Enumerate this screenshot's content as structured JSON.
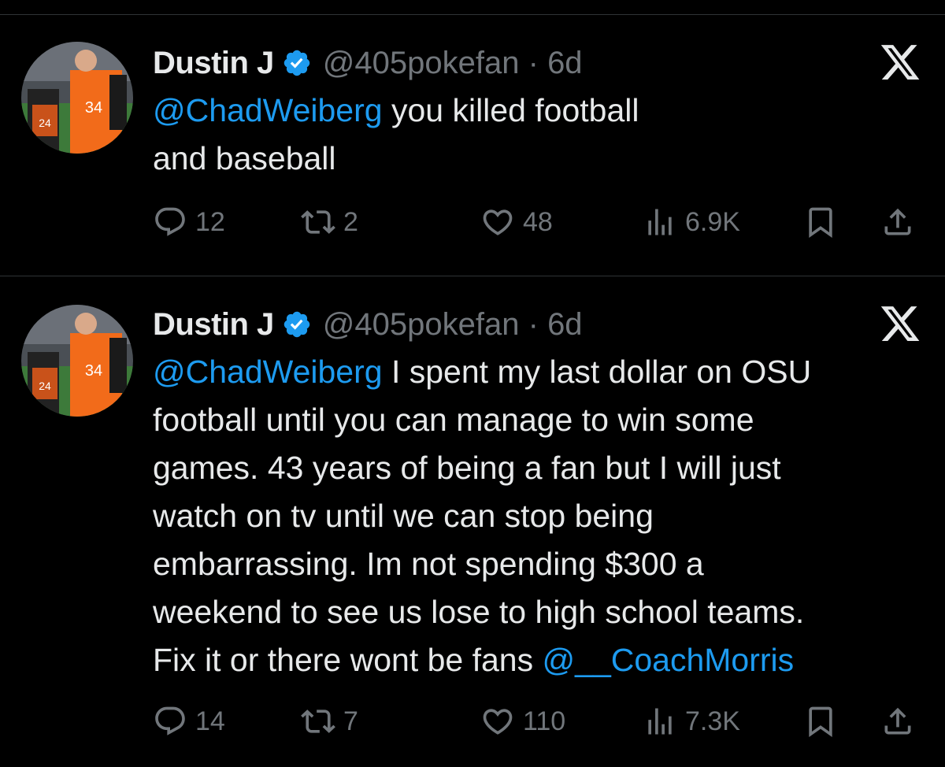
{
  "tweets": [
    {
      "name": "Dustin J",
      "handle": "@405pokefan",
      "separator": "·",
      "time": "6d",
      "body_mention": "@ChadWeiberg",
      "body_line1_rest": " you killed football",
      "body_line2": "and baseball",
      "replies": "12",
      "retweets": "2",
      "likes": "48",
      "views": "6.9K"
    },
    {
      "name": "Dustin J",
      "handle": "@405pokefan",
      "separator": "·",
      "time": "6d",
      "body_mention_start": "@ChadWeiberg",
      "body_l1_rest": " I spent my last dollar on OSU",
      "body_l2": "football until you can manage to win some",
      "body_l3": "games. 43 years of being a fan but I will just",
      "body_l4": "watch on tv until we can stop being",
      "body_l5": "embarrassing. Im not spending $300 a",
      "body_l6": "weekend to see us lose to high school teams.",
      "body_l7_start": "Fix it or there wont be fans ",
      "body_mention_end": "@__CoachMorris",
      "replies": "14",
      "retweets": "7",
      "likes": "110",
      "views": "7.3K"
    }
  ],
  "icons": {
    "verified": "verified-badge-icon",
    "x_logo": "x-logo-icon",
    "reply": "reply-icon",
    "retweet": "retweet-icon",
    "like": "heart-icon",
    "views": "views-icon",
    "bookmark": "bookmark-icon",
    "share": "share-icon"
  },
  "colors": {
    "background": "#000000",
    "text": "#e7e9ea",
    "secondary": "#71767b",
    "link": "#1d9bf0",
    "verified": "#1d9bf0"
  }
}
